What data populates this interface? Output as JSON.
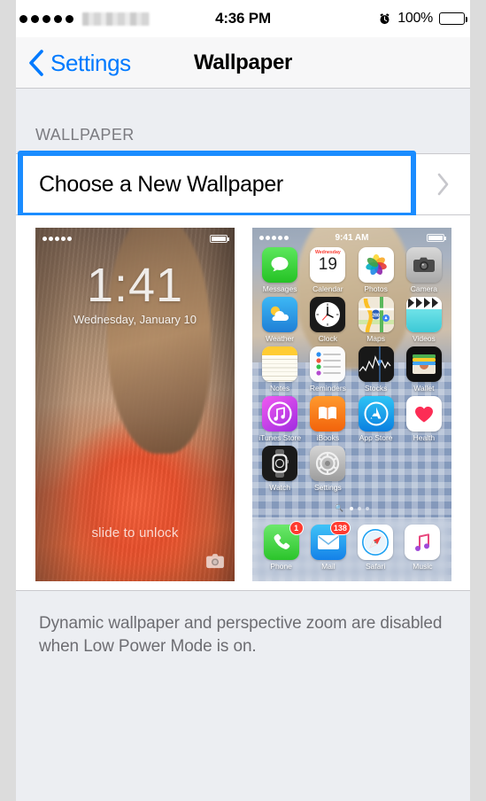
{
  "statusbar": {
    "signal_dots": 5,
    "carrier": "",
    "time": "4:36 PM",
    "alarm_icon": "alarm-clock-icon",
    "battery_percent": "100%",
    "battery_icon": "battery-full-icon"
  },
  "navbar": {
    "back_icon": "chevron-left-icon",
    "back_label": "Settings",
    "title": "Wallpaper"
  },
  "section": {
    "header": "WALLPAPER"
  },
  "choose_row": {
    "label": "Choose a New Wallpaper",
    "chevron_icon": "chevron-right-icon",
    "highlighted": true,
    "highlight_color": "#1a8cff"
  },
  "previews": {
    "lock": {
      "name": "lock-screen-preview",
      "signal_dots": 5,
      "time": "1:41",
      "date": "Wednesday, January 10",
      "slide_text": "slide to unlock",
      "camera_icon": "camera-icon"
    },
    "home": {
      "name": "home-screen-preview",
      "signal_dots": 5,
      "time": "9:41 AM",
      "apps": [
        {
          "label": "Messages",
          "icon": "messages-icon"
        },
        {
          "label": "Calendar",
          "icon": "calendar-icon",
          "weekday": "Wednesday",
          "day": "19"
        },
        {
          "label": "Photos",
          "icon": "photos-icon"
        },
        {
          "label": "Camera",
          "icon": "camera-app-icon"
        },
        {
          "label": "Weather",
          "icon": "weather-icon"
        },
        {
          "label": "Clock",
          "icon": "clock-icon"
        },
        {
          "label": "Maps",
          "icon": "maps-icon",
          "road_shield": "280"
        },
        {
          "label": "Videos",
          "icon": "videos-icon"
        },
        {
          "label": "Notes",
          "icon": "notes-icon"
        },
        {
          "label": "Reminders",
          "icon": "reminders-icon"
        },
        {
          "label": "Stocks",
          "icon": "stocks-icon"
        },
        {
          "label": "Wallet",
          "icon": "wallet-icon"
        },
        {
          "label": "iTunes Store",
          "icon": "itunes-store-icon"
        },
        {
          "label": "iBooks",
          "icon": "ibooks-icon"
        },
        {
          "label": "App Store",
          "icon": "app-store-icon"
        },
        {
          "label": "Health",
          "icon": "health-icon"
        },
        {
          "label": "Watch",
          "icon": "watch-icon"
        },
        {
          "label": "Settings",
          "icon": "settings-gear-icon"
        }
      ],
      "dock": [
        {
          "label": "Phone",
          "icon": "phone-icon",
          "badge": "1"
        },
        {
          "label": "Mail",
          "icon": "mail-icon",
          "badge": "138"
        },
        {
          "label": "Safari",
          "icon": "safari-icon",
          "badge": ""
        },
        {
          "label": "Music",
          "icon": "music-icon",
          "badge": ""
        }
      ],
      "page_dots": 3,
      "active_page": 1
    }
  },
  "footer": {
    "note": "Dynamic wallpaper and perspective zoom are disabled when Low Power Mode is on."
  }
}
